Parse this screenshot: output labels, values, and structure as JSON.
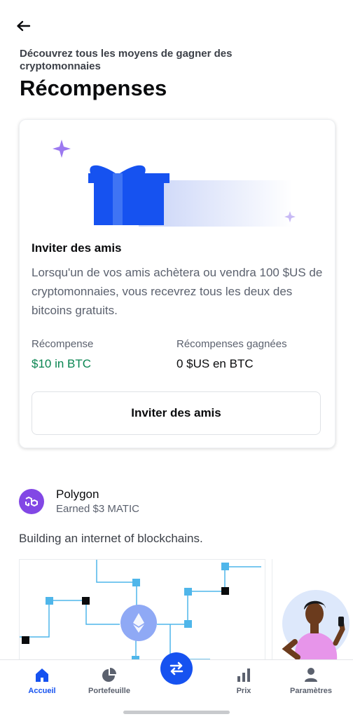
{
  "header": {
    "subtitle": "Découvrez tous les moyens de gagner des cryptomonnaies",
    "title": "Récompenses"
  },
  "invite_card": {
    "title": "Inviter des amis",
    "description": "Lorsqu'un de vos amis achètera ou vendra 100 $US de cryptomonnaies, vous recevrez tous les deux des bitcoins gratuits.",
    "reward_label": "Récompense",
    "reward_value": "$10 in BTC",
    "earned_label": "Récompenses gagnées",
    "earned_value": "0 $US en BTC",
    "button_label": "Inviter des amis"
  },
  "polygon": {
    "name": "Polygon",
    "earned": "Earned $3 MATIC",
    "description": "Building an internet of blockchains."
  },
  "nav": {
    "items": [
      {
        "label": "Accueil",
        "icon": "home-icon",
        "active": true
      },
      {
        "label": "Portefeuille",
        "icon": "pie-chart-icon",
        "active": false
      },
      {
        "label": "Prix",
        "icon": "bar-chart-icon",
        "active": false
      },
      {
        "label": "Paramètres",
        "icon": "person-icon",
        "active": false
      }
    ],
    "trade_icon": "swap-arrows-icon"
  },
  "colors": {
    "accent": "#1652f0",
    "positive": "#098551",
    "polygon": "#8247e5"
  }
}
